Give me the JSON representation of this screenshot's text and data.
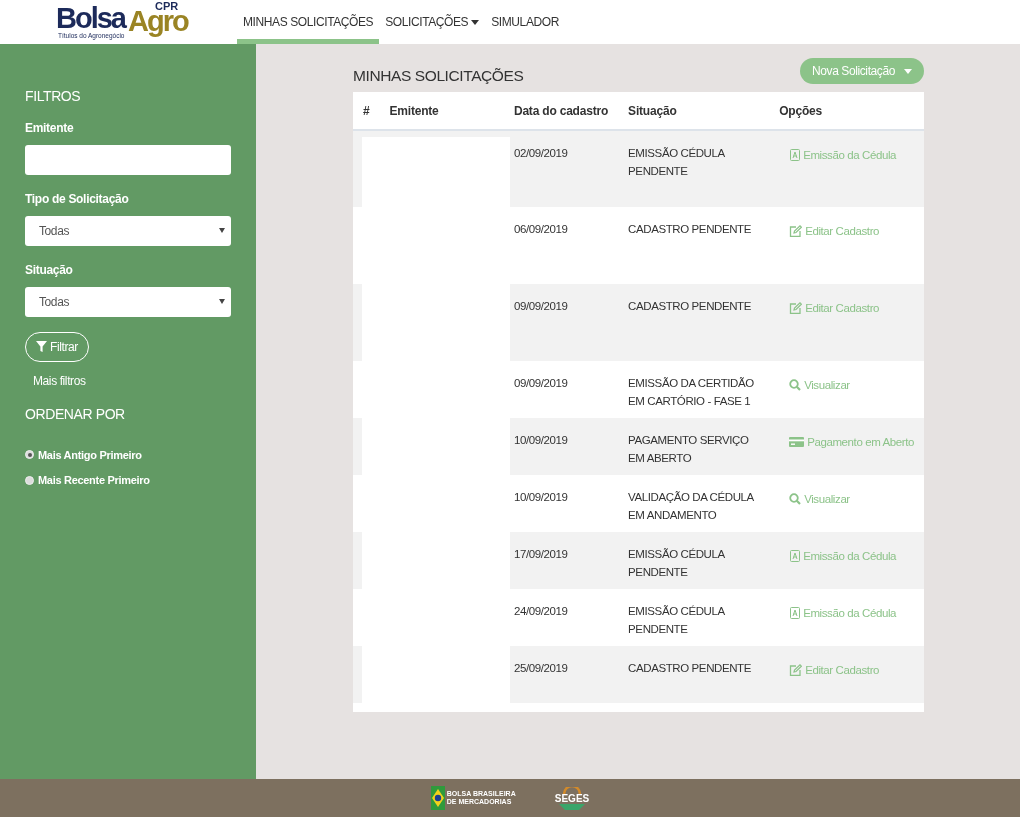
{
  "logo": {
    "word_1": "Bolsa",
    "word_2": "Agro",
    "superscript": "CPR",
    "tagline": "Títulos do Agronegócio"
  },
  "nav": [
    {
      "label": "MINHAS SOLICITAÇÕES",
      "selected": true,
      "dropdown": false
    },
    {
      "label": "SOLICITAÇÕES",
      "selected": false,
      "dropdown": true
    },
    {
      "label": "SIMULADOR",
      "selected": false,
      "dropdown": false
    }
  ],
  "sidebar": {
    "title": "FILTROS",
    "fields": [
      {
        "kind": "text",
        "label": "Emitente"
      },
      {
        "kind": "select",
        "label": "Tipo de Solicitação",
        "value": "Todas"
      },
      {
        "kind": "select",
        "label": "Situação",
        "value": "Todas"
      }
    ],
    "filter_button": "Filtrar",
    "more_filters": "Mais filtros",
    "sort_title": "ORDENAR POR",
    "sort_options": [
      {
        "label": "Mais Antigo Primeiro",
        "selected": true
      },
      {
        "label": "Mais Recente Primeiro",
        "selected": false
      }
    ]
  },
  "page_title": "MINHAS SOLICITAÇÕES",
  "new_button": "Nova Solicitação",
  "table": {
    "columns": [
      "#",
      "Emitente",
      "Data do cadastro",
      "Situação",
      "Opções"
    ],
    "rows": [
      {
        "date": "02/09/2019",
        "status": "EMISSÃO CÉDULA PENDENTE",
        "option": {
          "kind": "pdf",
          "label": "Emissão da Cédula"
        }
      },
      {
        "date": "06/09/2019",
        "status": "CADASTRO PENDENTE",
        "option": {
          "kind": "edit",
          "label": "Editar Cadastro"
        }
      },
      {
        "date": "09/09/2019",
        "status": "CADASTRO PENDENTE",
        "option": {
          "kind": "edit",
          "label": "Editar Cadastro"
        }
      },
      {
        "date": "09/09/2019",
        "status": "EMISSÃO DA CERTIDÃO EM CARTÓRIO - FASE 1",
        "option": {
          "kind": "view",
          "label": "Visualizar"
        }
      },
      {
        "date": "10/09/2019",
        "status": "PAGAMENTO SERVIÇO EM ABERTO",
        "option": {
          "kind": "payment",
          "label": "Pagamento em Aberto"
        }
      },
      {
        "date": "10/09/2019",
        "status": "VALIDAÇÃO DA CÉDULA EM ANDAMENTO",
        "option": {
          "kind": "view",
          "label": "Visualizar"
        }
      },
      {
        "date": "17/09/2019",
        "status": "EMISSÃO CÉDULA PENDENTE",
        "option": {
          "kind": "pdf",
          "label": "Emissão da Cédula"
        }
      },
      {
        "date": "24/09/2019",
        "status": "EMISSÃO CÉDULA PENDENTE",
        "option": {
          "kind": "pdf",
          "label": "Emissão da Cédula"
        }
      },
      {
        "date": "25/09/2019",
        "status": "CADASTRO PENDENTE",
        "option": {
          "kind": "edit",
          "label": "Editar Cadastro"
        }
      }
    ]
  },
  "footer": {
    "partner_1": "BOLSA BRASILEIRA DE MERCADORIAS",
    "partner_2": "SEGES"
  }
}
